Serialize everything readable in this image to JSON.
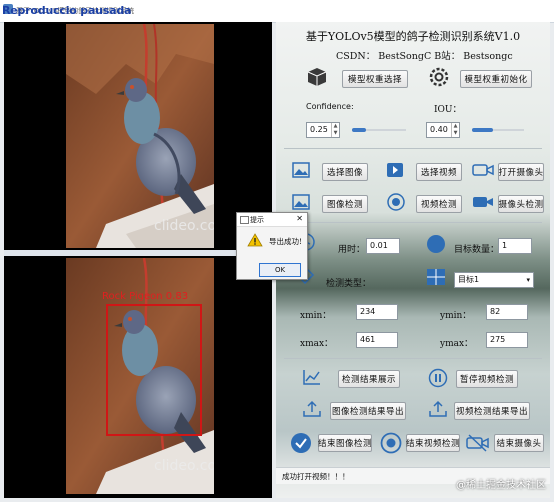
{
  "window": {
    "title": "基于YOLOv5模型的鸽子检测识别系统",
    "overlay_text": "Reproduccio pausada"
  },
  "left_panel": {
    "watermark": "clideo.com",
    "detection_label": "Rock Pigeon 0.83"
  },
  "header": {
    "title": "基于YOLOv5模型的鸽子检测识别系统V1.0",
    "credit": "CSDN：  BestSongC   B站：  Bestsongc"
  },
  "model": {
    "select_button": "模型权重选择",
    "init_button": "模型权重初始化"
  },
  "params": {
    "confidence_label": "Confidence:",
    "confidence_value": "0.25",
    "confidence_fraction": 0.25,
    "iou_label": "IOU：",
    "iou_value": "0.40",
    "iou_fraction": 0.4
  },
  "actions": {
    "select_image": "选择图像",
    "select_video": "选择视频",
    "open_camera": "打开摄像头",
    "image_detect": "图像检测",
    "video_detect": "视频检测",
    "camera_detect": "摄像头检测"
  },
  "results": {
    "time_label": "用时：",
    "time_value": "0.01",
    "count_label": "目标数量：",
    "count_value": "1",
    "type_label": "检测类型：",
    "target_select": "目标1",
    "xmin_label": "xmin：",
    "xmin_value": "234",
    "ymin_label": "ymin：",
    "ymin_value": "82",
    "xmax_label": "xmax：",
    "xmax_value": "461",
    "ymax_label": "ymax：",
    "ymax_value": "275"
  },
  "controls": {
    "show_results": "检测结果展示",
    "pause_video": "暂停视频检测",
    "export_image": "图像检测结果导出",
    "export_video": "视频检测结果导出",
    "end_image": "结束图像检测",
    "end_video": "结束视频检测",
    "end_camera": "结束摄像头"
  },
  "status": {
    "message": "成功打开视频！！！"
  },
  "dialog": {
    "title": "提示",
    "message": "导出成功!",
    "ok": "OK"
  },
  "corner_watermark": "@稀土掘金技术社区",
  "colors": {
    "accent": "#3d78c4",
    "detection_box": "#d01616"
  }
}
